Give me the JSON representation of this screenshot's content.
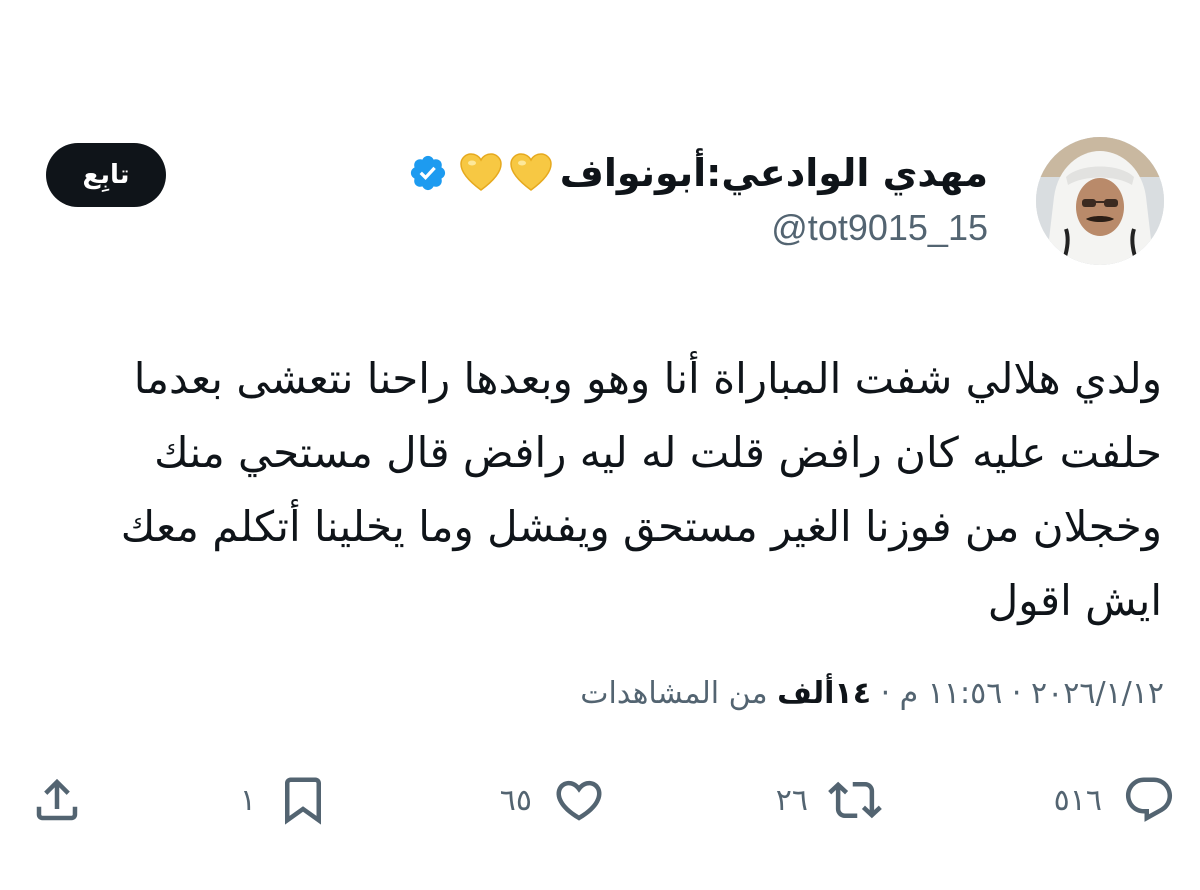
{
  "author": {
    "display_name": "مهدي الوادعي:أبونواف",
    "handle": "@tot9015_15",
    "emoji": [
      "yellow-heart-icon",
      "yellow-heart-icon"
    ],
    "verified": true,
    "verified_color": "#1d9bf0"
  },
  "follow_button": {
    "label": "تابِع"
  },
  "tweet": {
    "text": "ولدي هلالي شفت المباراة أنا وهو وبعدها راحنا نتعشى بعدما\nحلفت عليه كان رافض قلت له ليه رافض قال مستحي منك\nوخجلان من فوزنا الغير مستحق ويفشل وما يخلينا أتكلم معك\nايش اقول"
  },
  "meta": {
    "date": "٢٠٢٦/١/١٢",
    "separator": "·",
    "time": "١١:٥٦ م",
    "views_count": "١٤ألف",
    "views_label": "من المشاهدات"
  },
  "actions": {
    "replies": "٥١٦",
    "retweets": "٢٦",
    "likes": "٦٥",
    "bookmarks": "١"
  },
  "colors": {
    "text_primary": "#0f1419",
    "text_secondary": "#536471",
    "heart": "#f7c843",
    "button_bg": "#0f1419"
  }
}
